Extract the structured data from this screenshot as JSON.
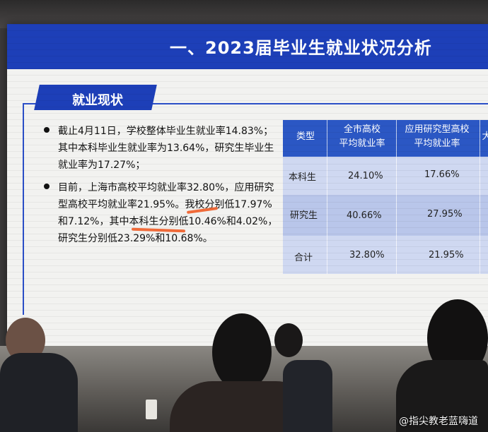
{
  "slide": {
    "title": "一、2023届毕业生就业状况分析",
    "section_tag": "就业现状"
  },
  "bullets": [
    {
      "lines": [
        "截止4月11日，学校整体毕业生就业率14.83%；",
        "其中本科毕业生就业率为13.64%，研究生毕业生",
        "就业率为17.27%；"
      ]
    },
    {
      "lines": [
        "目前，上海市高校平均就业率32.80%，应用研究",
        "型高校平均就业率21.95%。我校分别低17.97%",
        "和7.12%，其中本科生分别低10.46%和4.02%，",
        "研究生分别低23.29%和10.68%。"
      ]
    }
  ],
  "table": {
    "headers": [
      "类型",
      "全市高校\n平均就业率",
      "应用研究型高校\n平均就业率",
      "大"
    ],
    "rows": [
      [
        "本科生",
        "24.10%",
        "17.66%"
      ],
      [
        "研究生",
        "40.66%",
        "27.95%"
      ],
      [
        "合计",
        "32.80%",
        "21.95%"
      ]
    ]
  },
  "watermark": "@指尖教老蓝嗨道",
  "colors": {
    "title_band": "#1d3fb8",
    "table_header": "#2b57c4",
    "highlight": "#f06b3a"
  }
}
